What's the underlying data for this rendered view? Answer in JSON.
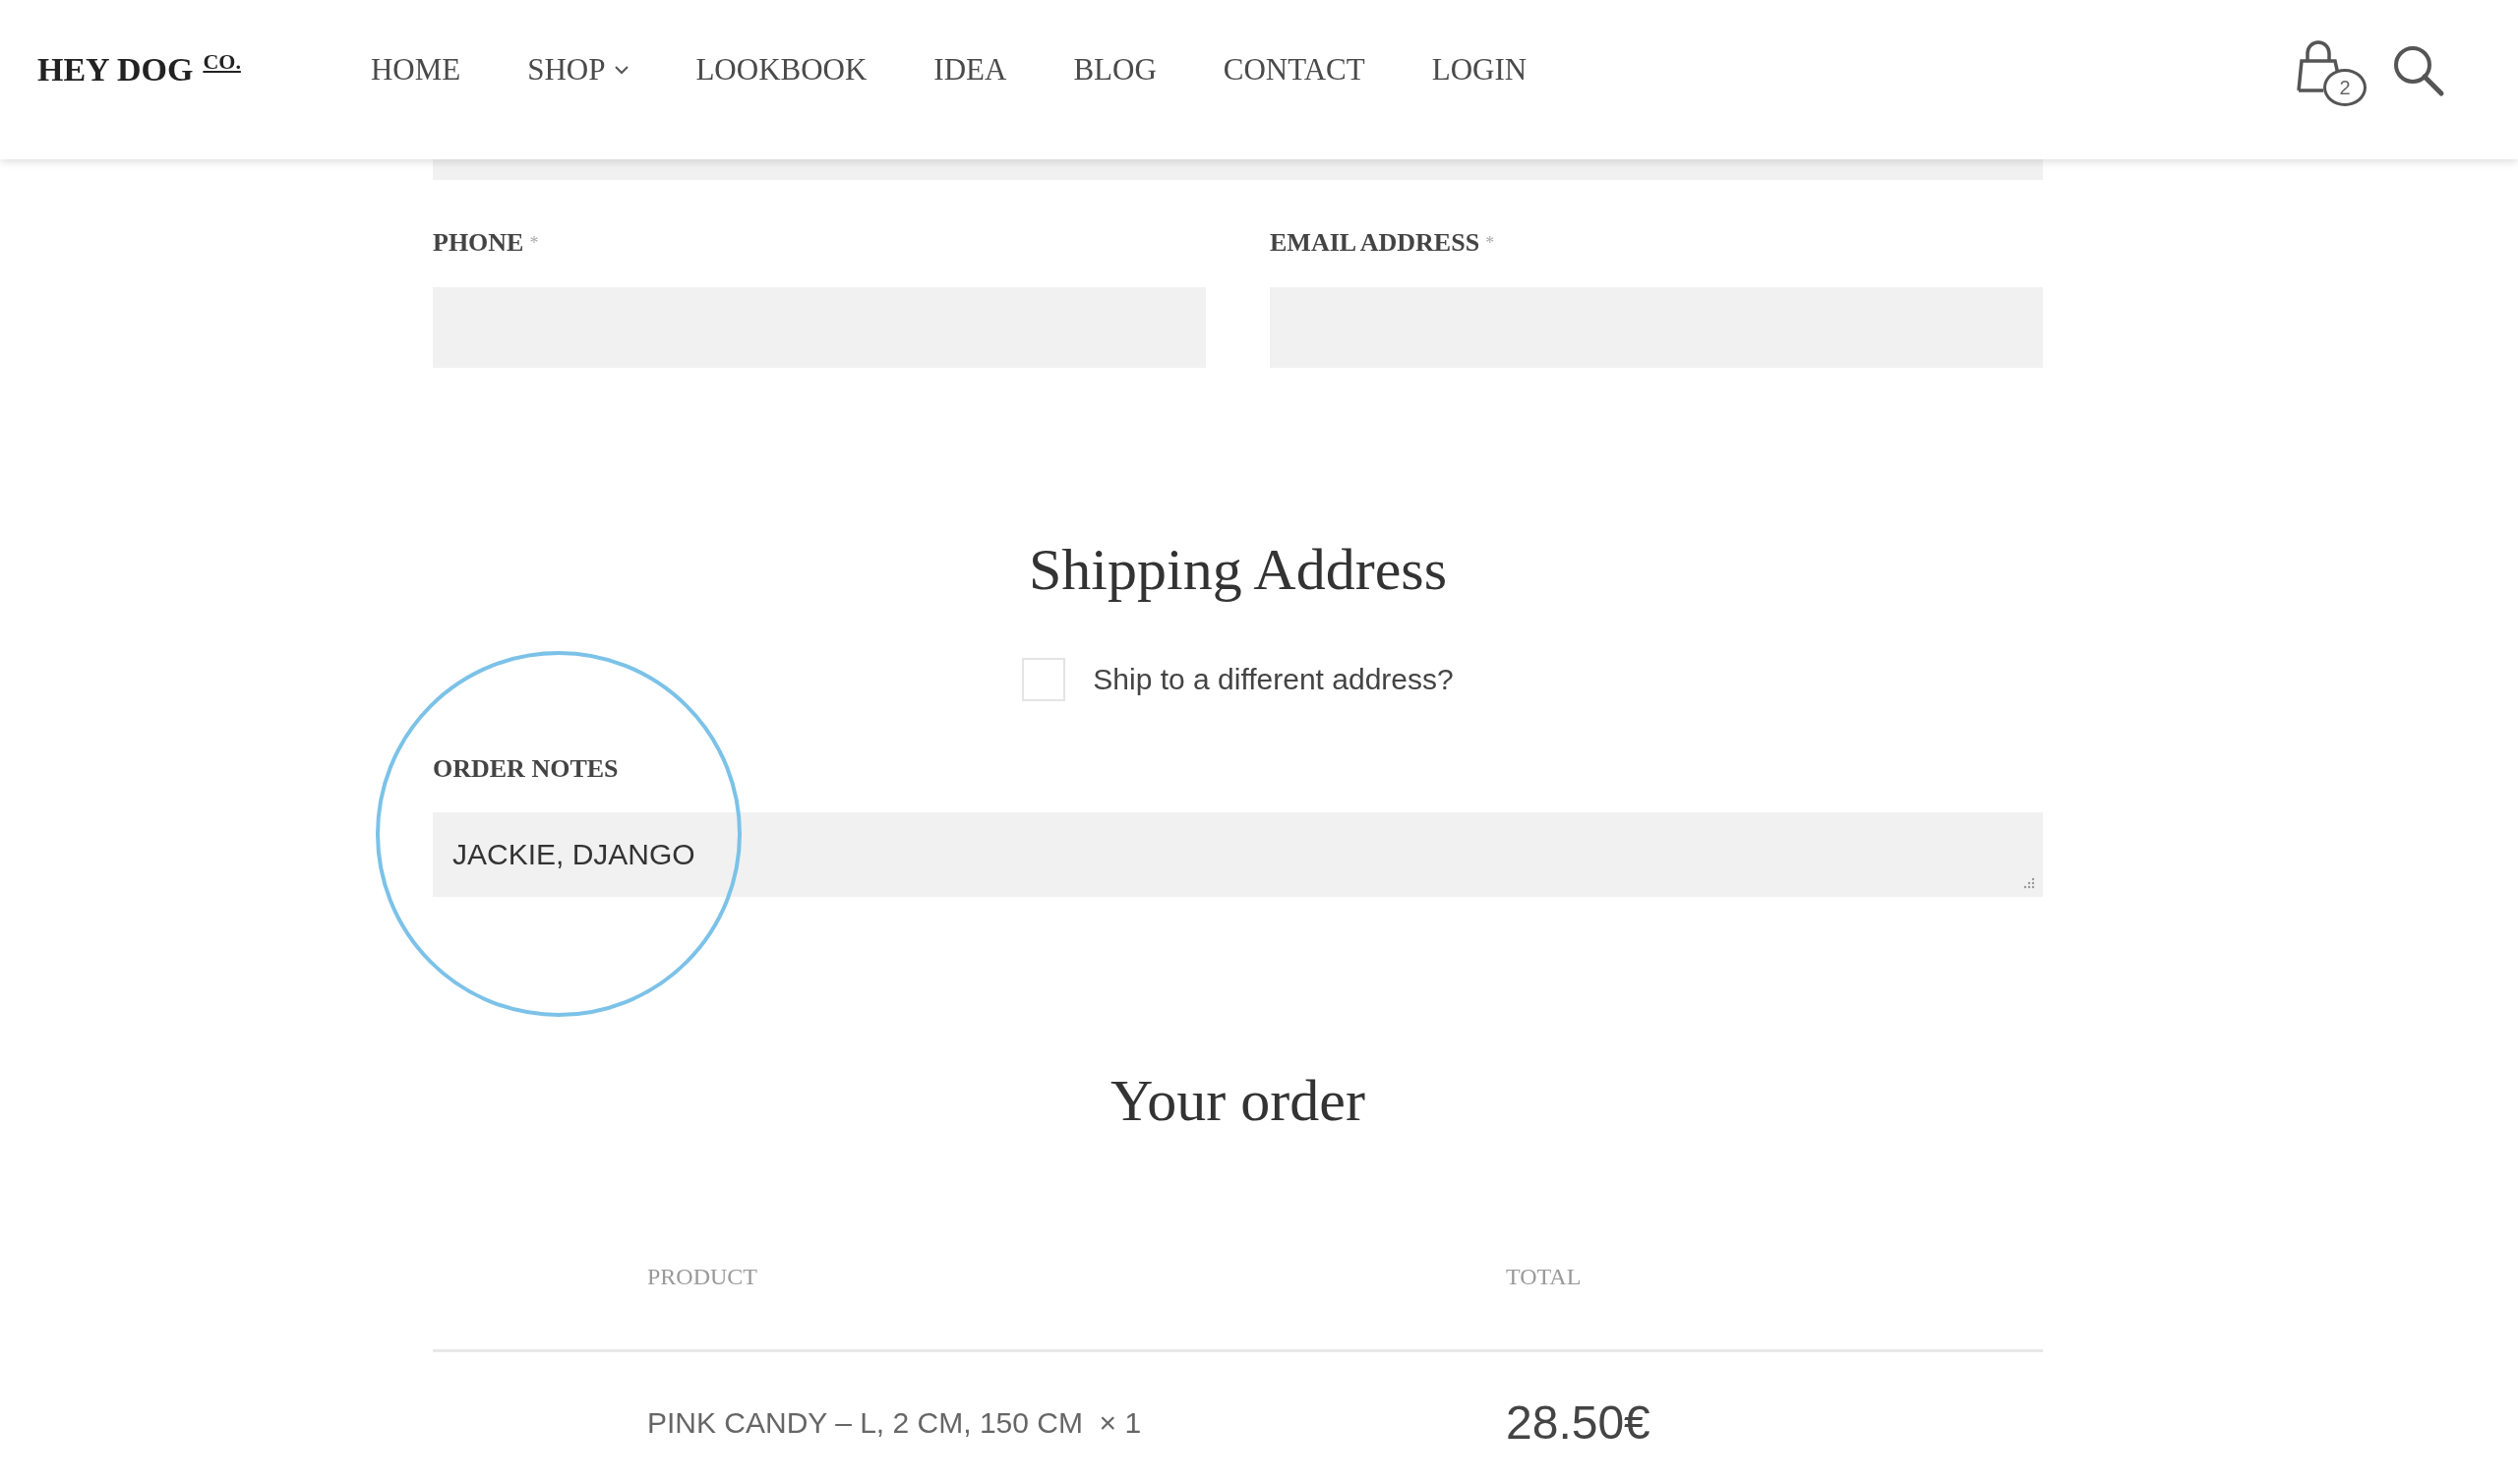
{
  "header": {
    "logo": "HEY DOG",
    "logo_mark": "CO.",
    "nav": [
      {
        "label": "HOME",
        "dropdown": false
      },
      {
        "label": "SHOP",
        "dropdown": true
      },
      {
        "label": "LOOKBOOK",
        "dropdown": false
      },
      {
        "label": "IDEA",
        "dropdown": false
      },
      {
        "label": "BLOG",
        "dropdown": false
      },
      {
        "label": "CONTACT",
        "dropdown": false
      },
      {
        "label": "LOGIN",
        "dropdown": false
      }
    ],
    "cart_count": "2"
  },
  "billing": {
    "fields": [
      {
        "label": "PHONE",
        "marker": "*"
      },
      {
        "label": "EMAIL ADDRESS",
        "marker": "*"
      }
    ]
  },
  "shipping": {
    "title": "Shipping Address",
    "checkbox": {
      "label": "Ship to a different address?",
      "checked": false
    }
  },
  "order_notes": {
    "label": "ORDER NOTES",
    "value": "JACKIE, DJANGO"
  },
  "order": {
    "title": "Your order",
    "columns": [
      "PRODUCT",
      "TOTAL"
    ],
    "rows": [
      {
        "product": "PINK CANDY – L, 2 CM, 150 CM",
        "quantity": "× 1",
        "total": "28.50€"
      }
    ]
  }
}
